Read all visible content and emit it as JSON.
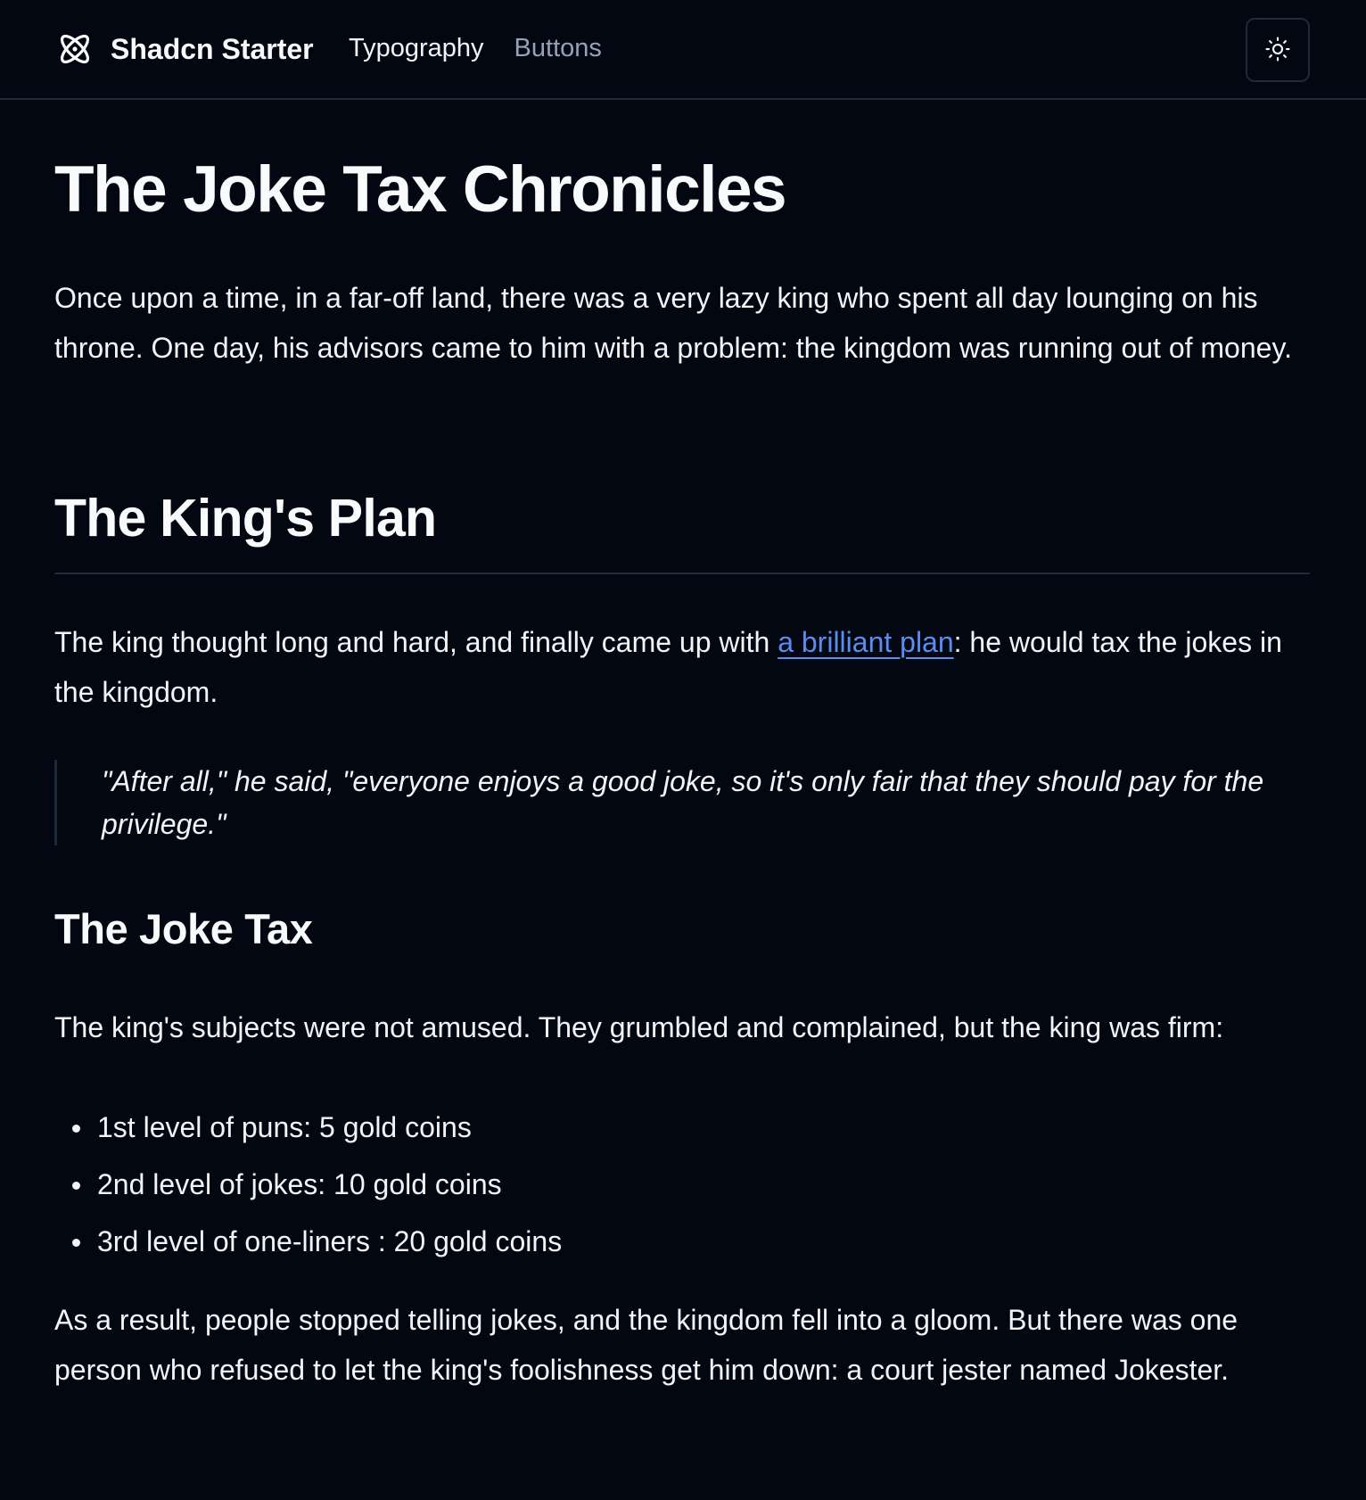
{
  "nav": {
    "brand": "Shadcn Starter",
    "brand_icon": "react-atom-icon",
    "links": [
      {
        "label": "Typography",
        "active": true
      },
      {
        "label": "Buttons",
        "active": false
      }
    ],
    "theme_toggle_icon": "sun-icon"
  },
  "article": {
    "title": "The Joke Tax Chronicles",
    "intro": "Once upon a time, in a far-off land, there was a very lazy king who spent all day lounging on his throne. One day, his advisors came to him with a problem: the kingdom was running out of money.",
    "section1": {
      "heading": "The King's Plan",
      "para_before_link": "The king thought long and hard, and finally came up with ",
      "link_text": "a brilliant plan",
      "para_after_link": ": he would tax the jokes in the kingdom.",
      "quote": "\"After all,\" he said, \"everyone enjoys a good joke, so it's only fair that they should pay for the privilege.\""
    },
    "section2": {
      "heading": "The Joke Tax",
      "para": "The king's subjects were not amused. They grumbled and complained, but the king was firm:",
      "items": [
        "1st level of puns: 5 gold coins",
        "2nd level of jokes: 10 gold coins",
        "3rd level of one-liners : 20 gold coins"
      ],
      "closing": "As a result, people stopped telling jokes, and the kingdom fell into a gloom. But there was one person who refused to let the king's foolishness get him down: a court jester named Jokester."
    }
  },
  "colors": {
    "background": "#030712",
    "foreground": "#f8fafc",
    "muted": "#94a3b8",
    "border": "#1e293b",
    "link": "#5b8def"
  }
}
